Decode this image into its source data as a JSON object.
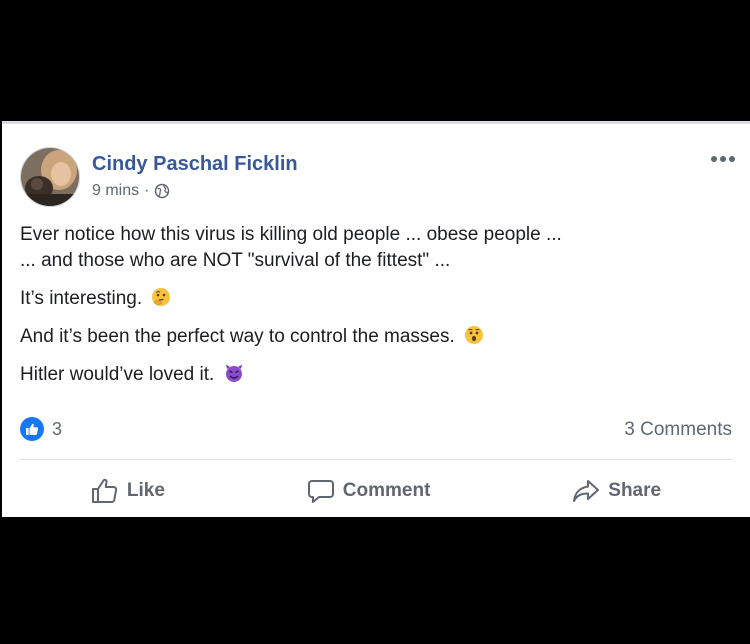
{
  "post": {
    "author": "Cindy Paschal Ficklin",
    "time": "9 mins",
    "separator": "·",
    "privacy_icon": "globe-icon",
    "menu_icon": "more-options-icon",
    "body": [
      {
        "text": "Ever notice how this virus is killing old people ... obese people ...",
        "emoji": null
      },
      {
        "text": "... and those who are NOT \"survival of the fittest\" ...",
        "emoji": null
      },
      {
        "text": "It’s interesting.",
        "emoji": "thinking-face-emoji"
      },
      {
        "text": "And it’s been the perfect way to control the masses.",
        "emoji": "hushed-face-emoji"
      },
      {
        "text": "Hitler would’ve loved it.",
        "emoji": "smiling-devil-emoji"
      }
    ],
    "reactions": {
      "icon": "like-reaction-icon",
      "count": "3"
    },
    "comments_label": "3 Comments",
    "actions": {
      "like": "Like",
      "comment": "Comment",
      "share": "Share"
    },
    "colors": {
      "author_link": "#385898",
      "facebook_blue": "#1877f2",
      "secondary_text": "#616770",
      "body_text": "#1c1e21",
      "background": "#000000"
    }
  }
}
